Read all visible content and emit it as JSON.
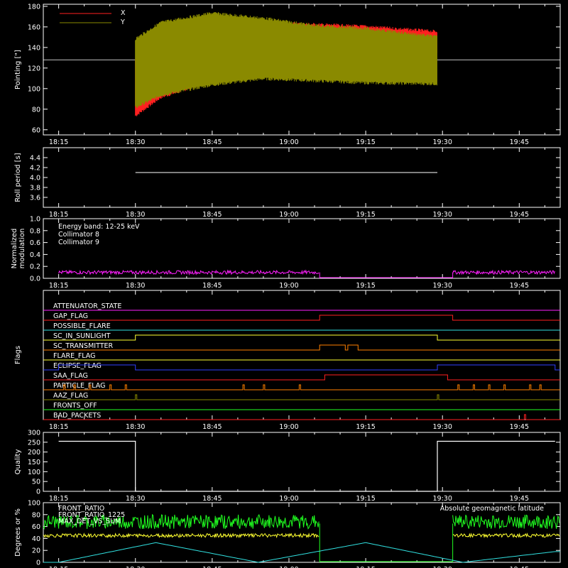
{
  "colors": {
    "bg": "#000000",
    "fg": "#ffffff",
    "x": "#ff2020",
    "y": "#8a8a00",
    "cyan": "#30e0e0",
    "magenta": "#ff20ff",
    "green": "#20ff20",
    "yellow": "#ffff30"
  },
  "time_ticks": [
    "18:15",
    "18:30",
    "18:45",
    "19:00",
    "19:15",
    "19:30",
    "19:45"
  ],
  "chart_data": [
    {
      "type": "line",
      "ylabel": "Pointing [\"]",
      "ylim": [
        55,
        182
      ],
      "yticks": [
        60,
        80,
        100,
        120,
        140,
        160,
        180
      ],
      "legend": [
        "X",
        "Y"
      ],
      "reference_line": 128,
      "data_span": [
        "18:30",
        "19:29"
      ],
      "series": [
        {
          "name": "X",
          "x": [
            "18:30",
            "18:35",
            "18:45",
            "18:55",
            "19:05",
            "19:15",
            "19:29"
          ],
          "upper": [
            130,
            160,
            168,
            166,
            164,
            162,
            157
          ],
          "lower": [
            72,
            90,
            106,
            118,
            124,
            128,
            132
          ]
        },
        {
          "name": "Y",
          "x": [
            "18:30",
            "18:35",
            "18:45",
            "18:55",
            "19:05",
            "19:15",
            "19:29"
          ],
          "upper": [
            150,
            166,
            175,
            170,
            163,
            160,
            152
          ],
          "lower": [
            80,
            92,
            102,
            108,
            106,
            104,
            103
          ]
        }
      ]
    },
    {
      "type": "line",
      "ylabel": "Roll period [s]",
      "ylim": [
        3.4,
        4.6
      ],
      "yticks": [
        "3.6",
        "3.8",
        "4.0",
        "4.2",
        "4.4"
      ],
      "series": [
        {
          "x": [
            "18:30",
            "19:29"
          ],
          "values": [
            4.1,
            4.1
          ]
        }
      ]
    },
    {
      "type": "line",
      "ylabel": [
        "Normalized",
        "modulation"
      ],
      "ylim": [
        0,
        1
      ],
      "yticks": [
        "0.0",
        "0.2",
        "0.4",
        "0.6",
        "0.8",
        "1.0"
      ],
      "legend": [
        "Energy band: 12-25 keV",
        "Collimator 8",
        "Collimator 9"
      ],
      "series": [
        {
          "name": "Collimator 9",
          "segments": [
            [
              "18:15",
              "19:06"
            ],
            [
              "19:32",
              "19:52"
            ]
          ],
          "level": 0.1
        }
      ]
    },
    {
      "type": "table",
      "ylabel": "Flags",
      "flags": [
        {
          "name": "ATTENUATOR_STATE",
          "color": "#ff20ff",
          "steps": []
        },
        {
          "name": "GAP_FLAG",
          "color": "#ff2020",
          "steps": [
            [
              "19:06",
              "19:32"
            ]
          ]
        },
        {
          "name": "POSSIBLE_FLARE",
          "color": "#30e0e0",
          "steps": []
        },
        {
          "name": "SC_IN_SUNLIGHT",
          "color": "#ffff30",
          "steps": [
            [
              "18:30",
              "19:29"
            ]
          ]
        },
        {
          "name": "SC_TRANSMITTER",
          "color": "#ff8000",
          "steps": [
            [
              "19:06",
              "19:11"
            ],
            [
              "19:11.5",
              "19:13.5"
            ]
          ]
        },
        {
          "name": "FLARE_FLAG",
          "color": "#ffff30",
          "steps": []
        },
        {
          "name": "ECLIPSE_FLAG",
          "color": "#3040ff",
          "steps": [
            [
              "18:15",
              "18:30"
            ],
            [
              "19:29",
              "19:52"
            ]
          ]
        },
        {
          "name": "SAA_FLAG",
          "color": "#ff2020",
          "steps": [
            [
              "19:07",
              "19:31"
            ]
          ]
        },
        {
          "name": "PARTICLE_FLAG",
          "color": "#ff8000",
          "spikes": [
            "18:16",
            "18:18",
            "18:21",
            "18:25",
            "18:28",
            "18:51",
            "18:55",
            "19:02",
            "19:33",
            "19:36",
            "19:39",
            "19:42",
            "19:47",
            "19:49"
          ]
        },
        {
          "name": "AAZ_FLAG",
          "color": "#8a8a00",
          "spikes": [
            "18:30",
            "19:29"
          ]
        },
        {
          "name": "FRONTS_OFF",
          "color": "#20ff20",
          "steps": []
        },
        {
          "name": "BAD_PACKETS",
          "color": "#ff2020",
          "spikes": [
            "19:46"
          ]
        }
      ]
    },
    {
      "type": "line",
      "ylabel": "Quality",
      "ylim": [
        0,
        300
      ],
      "yticks": [
        0,
        50,
        100,
        150,
        200,
        250,
        300
      ],
      "series": [
        {
          "x": [
            "18:15",
            "18:30",
            "18:30",
            "19:29",
            "19:29",
            "19:52"
          ],
          "values": [
            255,
            255,
            0,
            0,
            255,
            255
          ]
        }
      ]
    },
    {
      "type": "line",
      "ylabel": "Degrees or %",
      "ylim": [
        0,
        100
      ],
      "yticks": [
        0,
        20,
        40,
        60,
        80,
        100
      ],
      "legend": [
        "FRONT_RATIO",
        "FRONT_RATIO_1225",
        "MAX_DET_VS_SUM",
        "Absolute geomagnetic latitude"
      ],
      "series": [
        {
          "name": "FRONT_RATIO",
          "level": 68
        },
        {
          "name": "MAX_DET_VS_SUM",
          "level": 45
        },
        {
          "name": "Absolute geomagnetic latitude",
          "x": [
            "18:15",
            "18:34",
            "18:54",
            "19:15",
            "19:34",
            "19:52"
          ],
          "values": [
            0,
            33,
            0,
            33,
            0,
            18
          ]
        }
      ]
    }
  ]
}
